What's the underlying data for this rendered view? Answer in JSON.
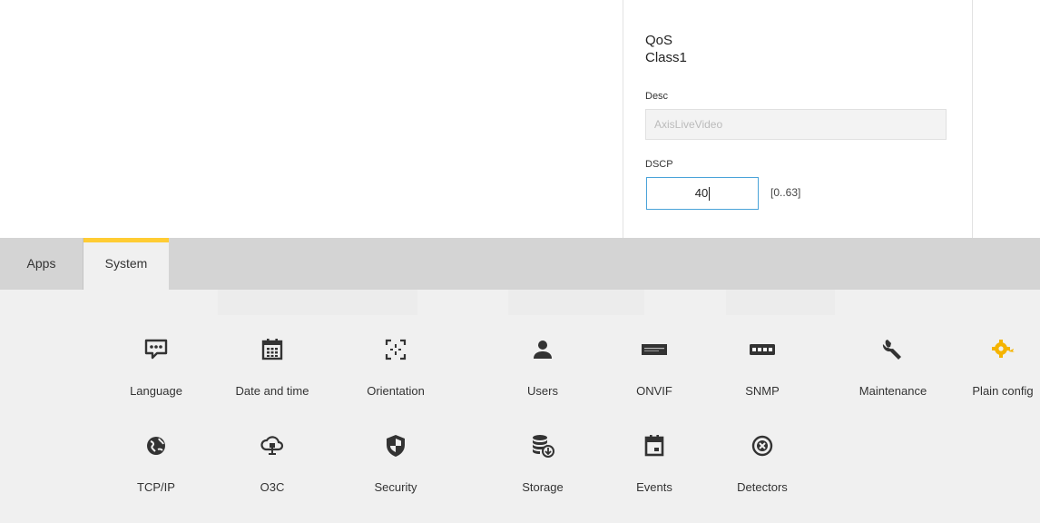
{
  "qos": {
    "title_line1": "QoS",
    "title_line2": "Class1",
    "desc_label": "Desc",
    "desc_value": "AxisLiveVideo",
    "dscp_label": "DSCP",
    "dscp_value": "40",
    "dscp_range": "[0..63]"
  },
  "tabs": {
    "apps": "Apps",
    "system": "System",
    "active": "System"
  },
  "colors": {
    "accent": "#ffcc33",
    "focus_border": "#4aa3d9",
    "tab_bar": "#d4d4d4",
    "content_bg": "#f0f0f0",
    "icon_dark": "#333333",
    "icon_yellow": "#f5b400"
  },
  "system_items": [
    {
      "label": "Language",
      "icon": "speech-bubble-icon"
    },
    {
      "label": "Date and time",
      "icon": "calendar-icon"
    },
    {
      "label": "Orientation",
      "icon": "orientation-icon"
    },
    {
      "label": "Users",
      "icon": "user-icon"
    },
    {
      "label": "ONVIF",
      "icon": "onvif-logo-icon"
    },
    {
      "label": "SNMP",
      "icon": "snmp-badge-icon"
    },
    {
      "label": "Maintenance",
      "icon": "wrench-icon"
    },
    {
      "label": "Plain config",
      "icon": "gear-plug-icon"
    },
    {
      "label": "TCP/IP",
      "icon": "globe-icon"
    },
    {
      "label": "O3C",
      "icon": "cloud-connect-icon"
    },
    {
      "label": "Security",
      "icon": "shield-icon"
    },
    {
      "label": "Storage",
      "icon": "storage-icon"
    },
    {
      "label": "Events",
      "icon": "event-calendar-icon"
    },
    {
      "label": "Detectors",
      "icon": "detector-icon"
    }
  ]
}
